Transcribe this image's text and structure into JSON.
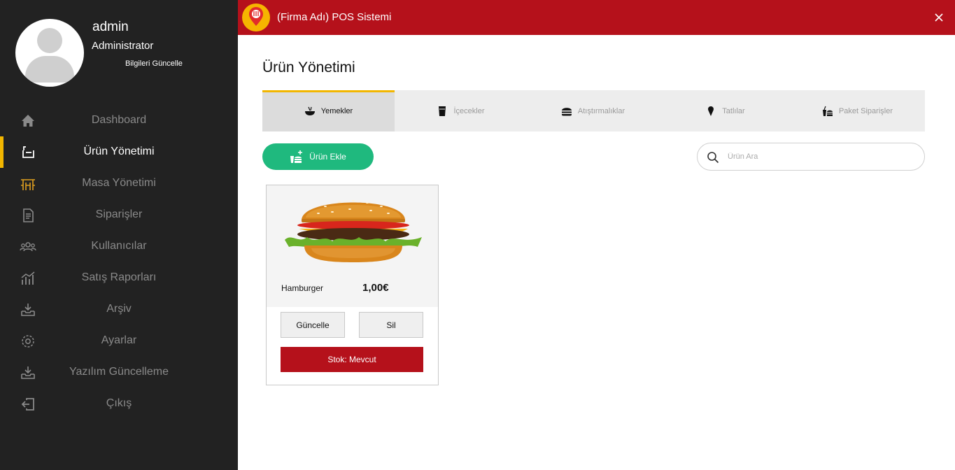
{
  "app": {
    "title": "(Firma Adı) POS Sistemi",
    "colors": {
      "brand_red": "#b5111b",
      "accent_yellow": "#f2b600",
      "sidebar_bg": "#222222",
      "success_green": "#1fb97e"
    }
  },
  "user": {
    "name": "admin",
    "role": "Administrator",
    "update_link": "Bilgileri Güncelle"
  },
  "sidebar": {
    "items": [
      {
        "label": "Dashboard",
        "icon": "home-icon",
        "active": false
      },
      {
        "label": "Ürün Yönetimi",
        "icon": "product-box-icon",
        "active": true
      },
      {
        "label": "Masa Yönetimi",
        "icon": "table-chairs-icon",
        "active": false
      },
      {
        "label": "Siparişler",
        "icon": "order-document-icon",
        "active": false
      },
      {
        "label": "Kullanıcılar",
        "icon": "users-icon",
        "active": false
      },
      {
        "label": "Satış Raporları",
        "icon": "sales-chart-icon",
        "active": false
      },
      {
        "label": "Arşiv",
        "icon": "archive-download-icon",
        "active": false
      },
      {
        "label": "Ayarlar",
        "icon": "gear-icon",
        "active": false
      },
      {
        "label": "Yazılım Güncelleme",
        "icon": "software-update-icon",
        "active": false
      },
      {
        "label": "Çıkış",
        "icon": "logout-icon",
        "active": false
      }
    ]
  },
  "main": {
    "page_title": "Ürün Yönetimi",
    "tabs": [
      {
        "label": "Yemekler",
        "icon": "food-bowl-icon",
        "active": true
      },
      {
        "label": "İçecekler",
        "icon": "drink-cup-icon",
        "active": false
      },
      {
        "label": "Atıştırmalıklar",
        "icon": "snack-burger-icon",
        "active": false
      },
      {
        "label": "Tatlılar",
        "icon": "ice-cream-icon",
        "active": false
      },
      {
        "label": "Paket Siparişler",
        "icon": "takeaway-icon",
        "active": false
      }
    ],
    "add_button_label": "Ürün Ekle",
    "search": {
      "placeholder": "Ürün Ara",
      "value": ""
    },
    "products": [
      {
        "name": "Hamburger",
        "price": "1,00€",
        "image": "hamburger-image",
        "update_label": "Güncelle",
        "delete_label": "Sil",
        "stock_label": "Stok: Mevcut"
      }
    ]
  }
}
